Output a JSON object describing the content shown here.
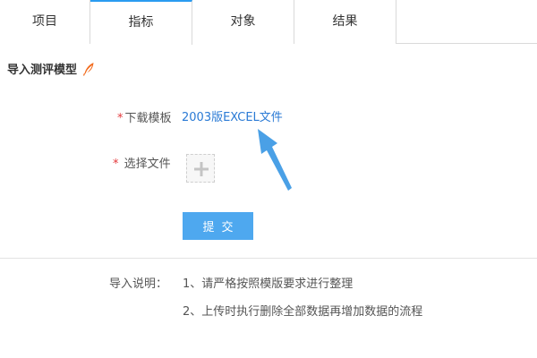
{
  "tabs": [
    {
      "label": "项目",
      "active": false
    },
    {
      "label": "指标",
      "active": true
    },
    {
      "label": "对象",
      "active": false
    },
    {
      "label": "结果",
      "active": false
    }
  ],
  "section": {
    "title": "导入测评模型",
    "icon": "feather-icon"
  },
  "form": {
    "required_mark": "*",
    "template_label": "下载模板",
    "template_link": "2003版EXCEL文件",
    "file_label": "选择文件",
    "upload_icon": "plus-icon",
    "submit_label": "提交"
  },
  "notes": {
    "label": "导入说明：",
    "items": [
      "1、请严格按照模版要求进行整理",
      "2、上传时执行删除全部数据再增加数据的流程"
    ]
  },
  "colors": {
    "accent": "#2a9bf0",
    "link": "#2a7ad5",
    "button": "#4ea8ef",
    "required": "#e4393c",
    "feather": "#f26b1d",
    "arrow": "#4aa0e6"
  }
}
